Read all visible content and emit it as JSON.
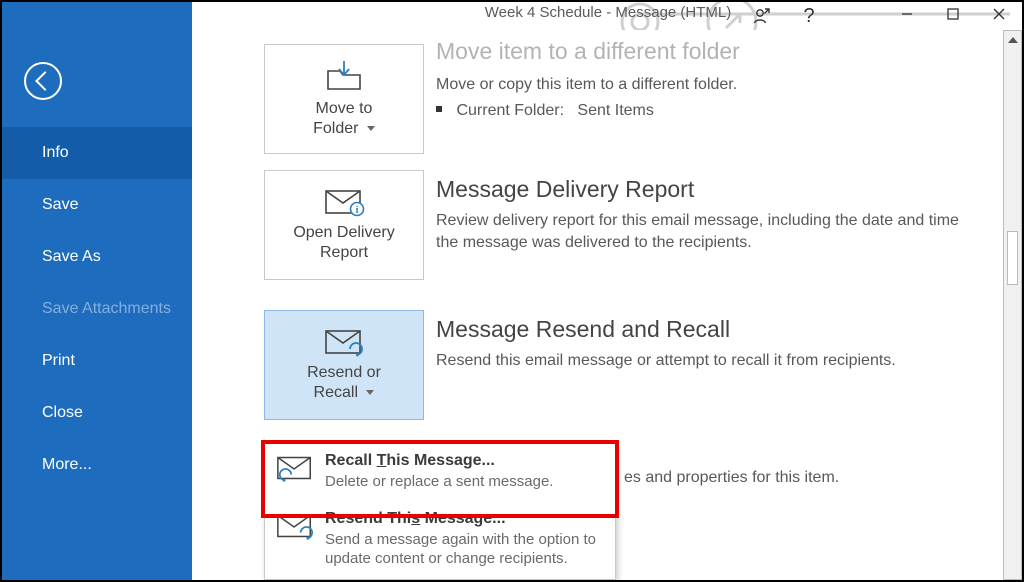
{
  "window_title": "Week 4 Schedule   -   Message (HTML)",
  "sidebar": {
    "items": [
      {
        "label": "Info",
        "selected": true
      },
      {
        "label": "Save"
      },
      {
        "label": "Save As"
      },
      {
        "label": "Save Attachments",
        "disabled": true
      },
      {
        "label": "Print"
      },
      {
        "label": "Close"
      },
      {
        "label": "More..."
      }
    ]
  },
  "move": {
    "tile_line1": "Move to",
    "tile_line2": "Folder",
    "title": "Move item to a different folder",
    "desc": "Move or copy this item to a different folder.",
    "current_folder_label": "Current Folder:",
    "current_folder_value": "Sent Items"
  },
  "delivery": {
    "tile_line1": "Open Delivery",
    "tile_line2": "Report",
    "title": "Message Delivery Report",
    "desc": "Review delivery report for this email message, including the date and time the message was delivered to the recipients."
  },
  "resend": {
    "tile_line1": "Resend or",
    "tile_line2": "Recall",
    "title": "Message Resend and Recall",
    "desc": "Resend this email message or attempt to recall it from recipients."
  },
  "partial_text": "es and properties for this item.",
  "menu": {
    "recall": {
      "title_pre": "Recall ",
      "title_acc": "T",
      "title_post": "his Message...",
      "desc": "Delete or replace a sent message."
    },
    "resend": {
      "title_pre": "Resend Thi",
      "title_acc": "s",
      "title_post": " Message...",
      "desc": "Send a message again with the option to update content or change recipients."
    }
  }
}
